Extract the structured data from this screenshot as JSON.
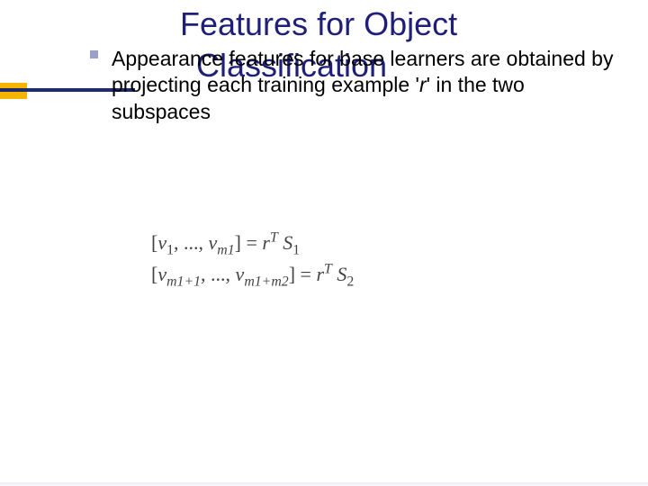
{
  "title_line1": "Features for Object",
  "title_line2": "Classification",
  "body_pre": "Appearance features for base learners are obtained by projecting each training example '",
  "body_var": "r",
  "body_post": "' in the two subspaces",
  "eq1_lhs_open": "[",
  "eq1_v": "v",
  "eq1_s1": "1",
  "eq1_sep": ", ..., ",
  "eq1_m1": "m1",
  "eq1_close": "]",
  "eq_eq": " = ",
  "eq_r": "r",
  "eq_T": "T",
  "eq_S": "S",
  "eq_Sub1": "1",
  "eq2_mlo": "m1+1",
  "eq2_mhi": "m1+m2",
  "eq_Sub2": "2"
}
